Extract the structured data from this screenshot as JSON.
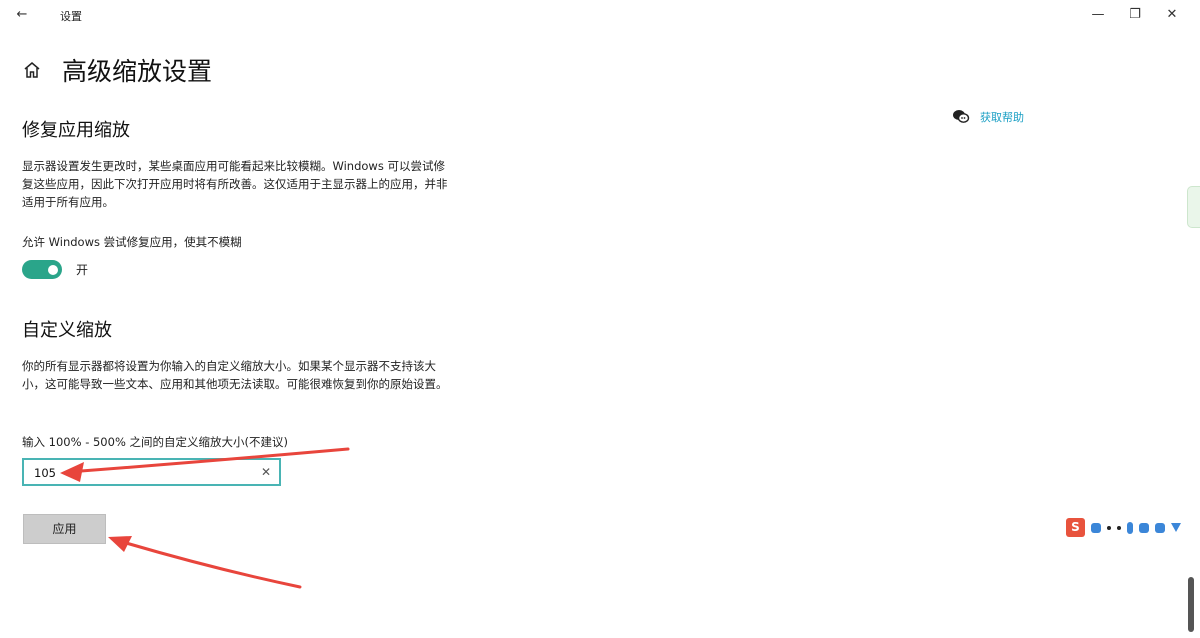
{
  "window": {
    "title": "设置",
    "back_glyph": "←",
    "minimize_glyph": "—",
    "maximize_glyph": "❐",
    "close_glyph": "✕"
  },
  "page": {
    "title": "高级缩放设置"
  },
  "help": {
    "label": "获取帮助"
  },
  "fix_scaling": {
    "title": "修复应用缩放",
    "description": "显示器设置发生更改时，某些桌面应用可能看起来比较模糊。Windows 可以尝试修复这些应用，因此下次打开应用时将有所改善。这仅适用于主显示器上的应用，并非适用于所有应用。",
    "toggle_label": "允许 Windows 尝试修复应用，使其不模糊",
    "toggle_state": "开",
    "toggle_on": true
  },
  "custom_scaling": {
    "title": "自定义缩放",
    "description": "你的所有显示器都将设置为你输入的自定义缩放大小。如果某个显示器不支持该大小，这可能导致一些文本、应用和其他项无法读取。可能很难恢复到你的原始设置。",
    "input_label": "输入 100% - 500% 之间的自定义缩放大小(不建议)",
    "input_value": "105",
    "clear_glyph": "✕",
    "apply_label": "应用"
  },
  "ime": {
    "logo": "S"
  },
  "colors": {
    "accent": "#2aa58a",
    "link": "#1a9fc4",
    "input_border": "#49b4b4",
    "annotation": "#e8453c"
  }
}
